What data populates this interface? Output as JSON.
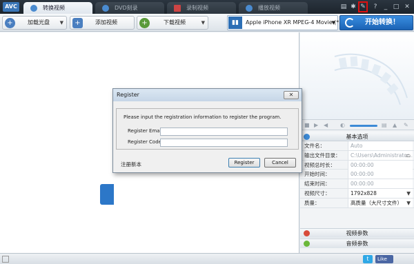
{
  "app": {
    "logo": "AVC"
  },
  "tabs": [
    {
      "label": "转换视频",
      "active": true
    },
    {
      "label": "DVD刻录",
      "active": false
    },
    {
      "label": "录制视频",
      "active": false
    },
    {
      "label": "播放视频",
      "active": false
    }
  ],
  "window_controls": {
    "help": "?",
    "minimize": "_",
    "maximize": "□",
    "close": "✕"
  },
  "toolbar": {
    "load_disc": "加载光盘",
    "add_video": "添加视频",
    "download_video": "下载视频",
    "profile": "Apple iPhone XR MPEG-4 Movie (*.m...",
    "convert": "开始转换！"
  },
  "settings": {
    "basic_header": "基本选项",
    "rows": [
      {
        "key": "文件名：",
        "value": "Auto"
      },
      {
        "key": "输出文件目录：",
        "value": "C:\\Users\\Administrator..."
      },
      {
        "key": "视频总时长：",
        "value": "00:00:00"
      },
      {
        "key": "开始时间：",
        "value": "00:00:00"
      },
      {
        "key": "结束时间：",
        "value": "00:00:00"
      },
      {
        "key": "视频尺寸：",
        "value": "1792x828"
      },
      {
        "key": "质量：",
        "value": "高质量（大尺寸文件）"
      }
    ],
    "video_params": "视频参数",
    "audio_params": "音频参数"
  },
  "dialog": {
    "title": "Register",
    "close": "✕",
    "message": "Please input the registration information to register the program.",
    "email_label": "Register Email:",
    "email_value": "",
    "code_label": "Register Code:",
    "code_value": "",
    "register_link": "注册新本",
    "register_button": "Register",
    "cancel_button": "Cancel"
  },
  "social": {
    "twitter": "t",
    "facebook": "Like"
  },
  "colors": {
    "accent": "#1b63b5",
    "topbar": "#1c242c",
    "highlight": "#e01010"
  }
}
